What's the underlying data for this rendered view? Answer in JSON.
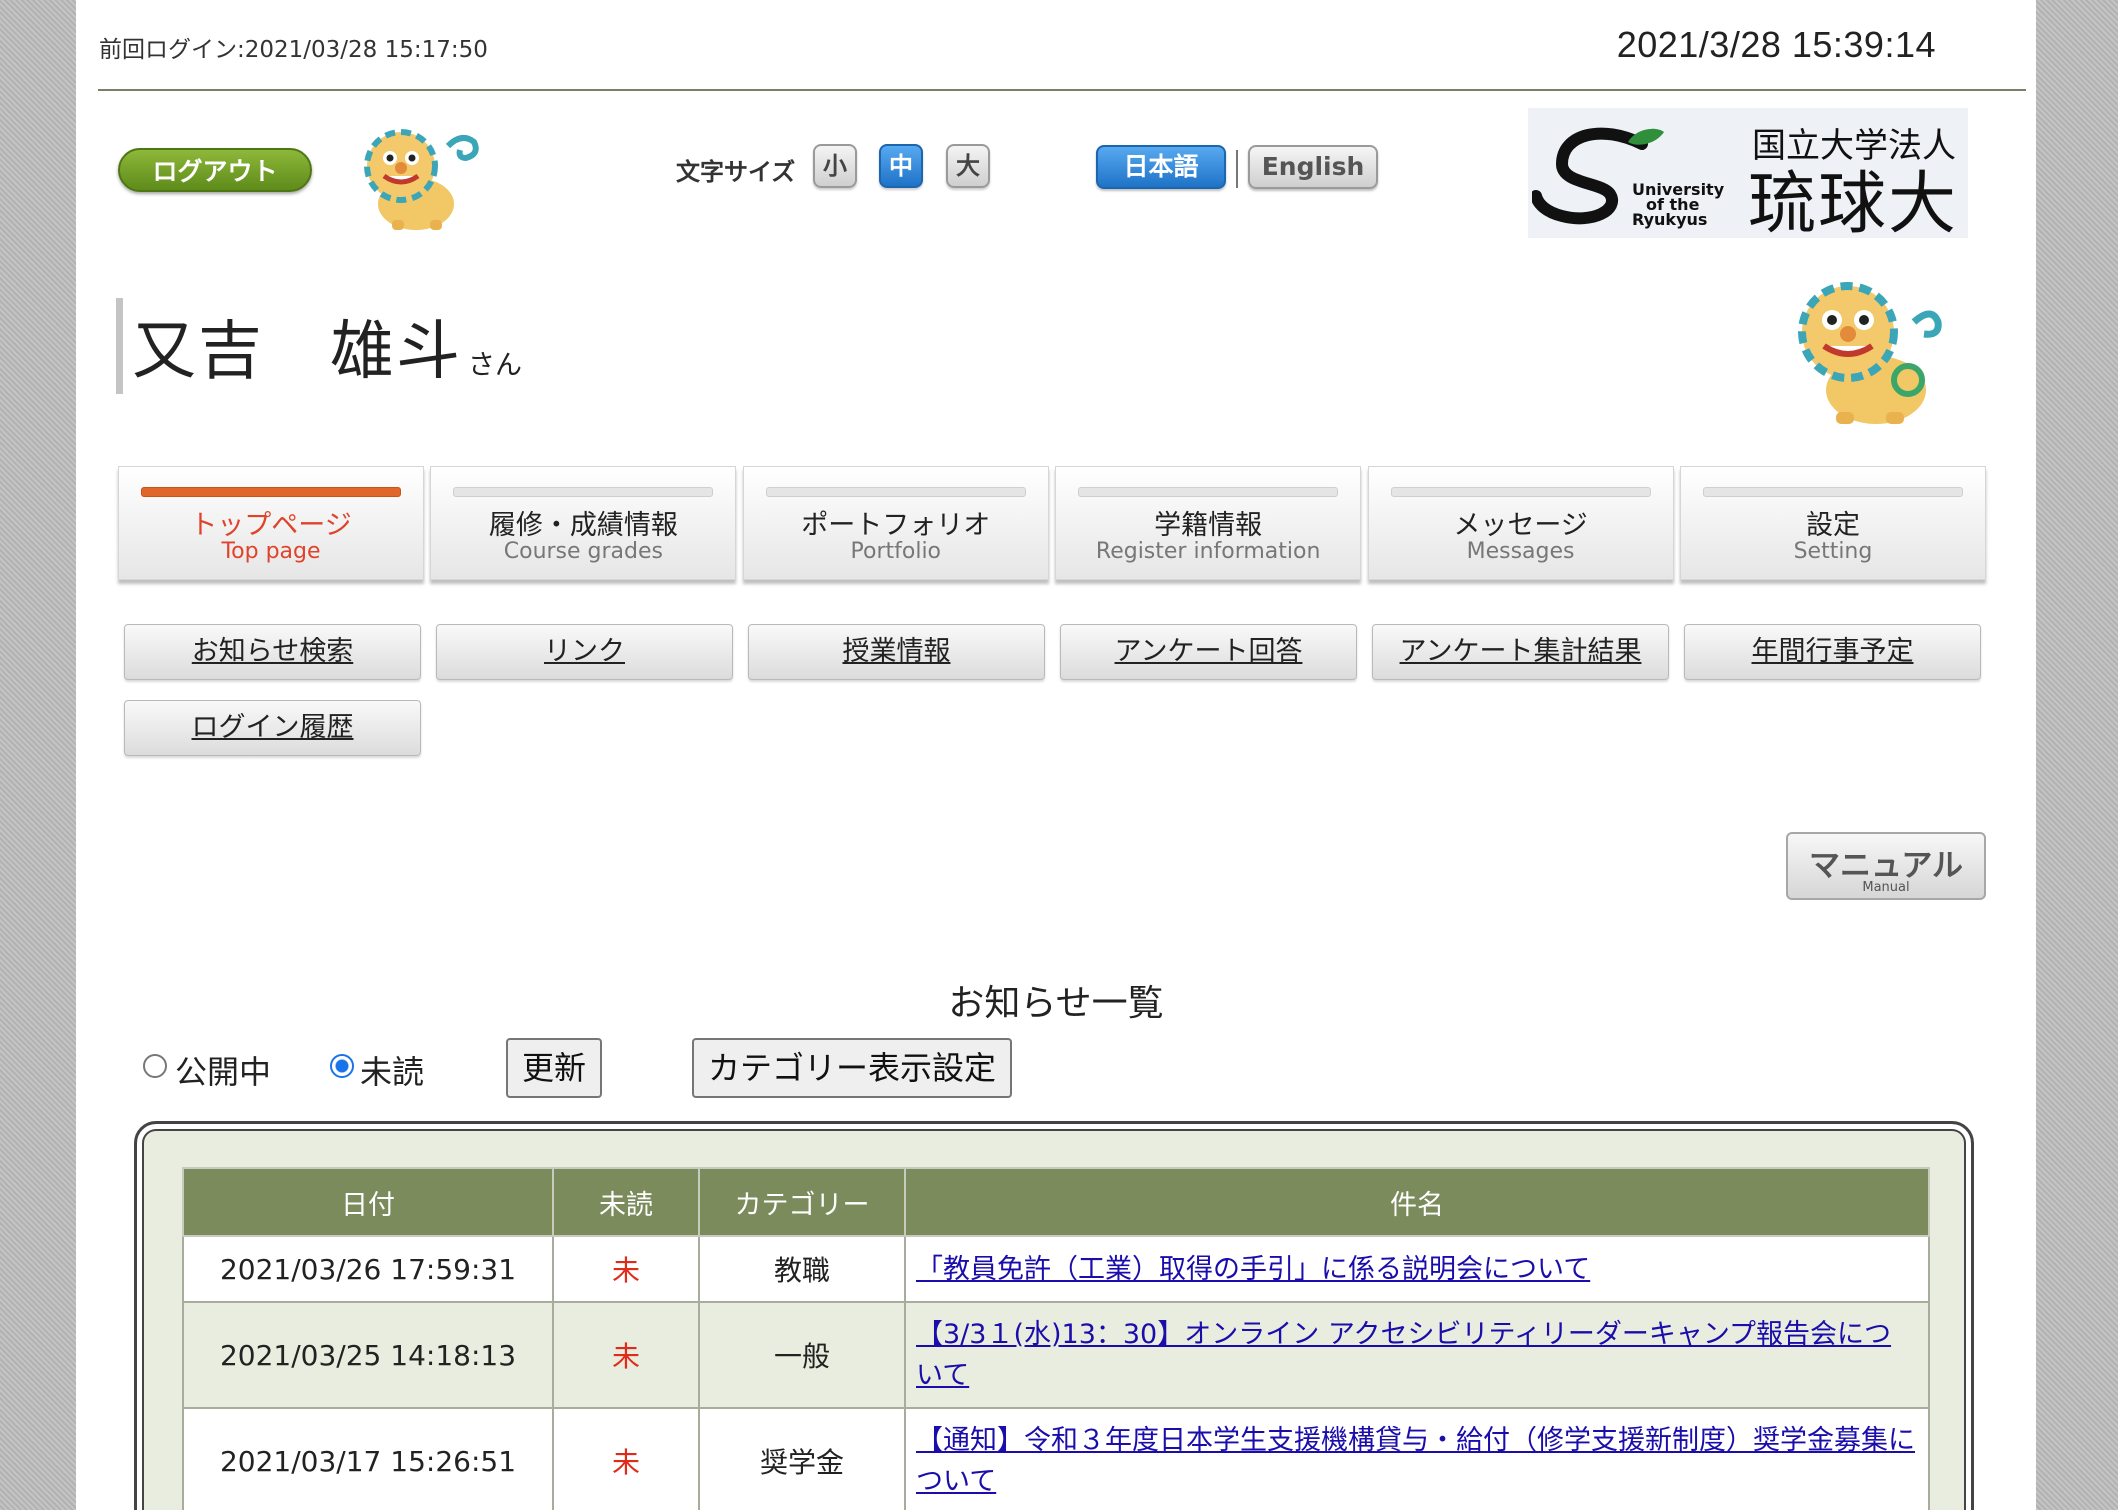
{
  "header": {
    "last_login": "前回ログイン:2021/03/28 15:17:50",
    "clock": "2021/3/28 15:39:14"
  },
  "toolbar": {
    "logout_label": "ログアウト",
    "font_size_label": "文字サイズ",
    "font_sizes": [
      {
        "label": "小",
        "active": false
      },
      {
        "label": "中",
        "active": true
      },
      {
        "label": "大",
        "active": false
      }
    ],
    "lang_ja": "日本語",
    "lang_en": "English"
  },
  "university": {
    "prefix": "国立大学法人",
    "name": "琉球大学",
    "en_line1": "University",
    "en_line2": "of the",
    "en_line3": "Ryukyus"
  },
  "user": {
    "name": "又吉　雄斗",
    "honorific": "さん"
  },
  "tabs": [
    {
      "ja": "トップページ",
      "en": "Top page",
      "active": true
    },
    {
      "ja": "履修・成績情報",
      "en": "Course grades",
      "active": false
    },
    {
      "ja": "ポートフォリオ",
      "en": "Portfolio",
      "active": false
    },
    {
      "ja": "学籍情報",
      "en": "Register information",
      "active": false
    },
    {
      "ja": "メッセージ",
      "en": "Messages",
      "active": false
    },
    {
      "ja": "設定",
      "en": "Setting",
      "active": false
    }
  ],
  "subnav": [
    "お知らせ検索",
    "リンク",
    "授業情報",
    "アンケート回答",
    "アンケート集計結果",
    "年間行事予定",
    "ログイン履歴"
  ],
  "manual": {
    "ja": "マニュアル",
    "en": "Manual"
  },
  "notices": {
    "title": "お知らせ一覧",
    "filter_public": "公開中",
    "filter_unread": "未読",
    "selected_filter": "未読",
    "refresh_label": "更新",
    "category_settings_label": "カテゴリー表示設定",
    "columns": [
      "日付",
      "未読",
      "カテゴリー",
      "件名"
    ],
    "rows": [
      {
        "date": "2021/03/26 17:59:31",
        "unread": "未",
        "category": "教職",
        "subject": "「教員免許（工業）取得の手引」に係る説明会について"
      },
      {
        "date": "2021/03/25 14:18:13",
        "unread": "未",
        "category": "一般",
        "subject": "【3/3１(水)13：30】オンライン アクセシビリティリーダーキャンプ報告会について"
      },
      {
        "date": "2021/03/17 15:26:51",
        "unread": "未",
        "category": "奨学金",
        "subject": "【通知】令和３年度日本学生支援機構貸与・給付（修学支援新制度）奨学金募集について"
      }
    ]
  },
  "colors": {
    "accent_orange": "#e0662a",
    "active_blue": "#1f73c7",
    "logout_green": "#6b9a22",
    "table_header": "#7b8b5c",
    "unread_red": "#e02a1a"
  }
}
